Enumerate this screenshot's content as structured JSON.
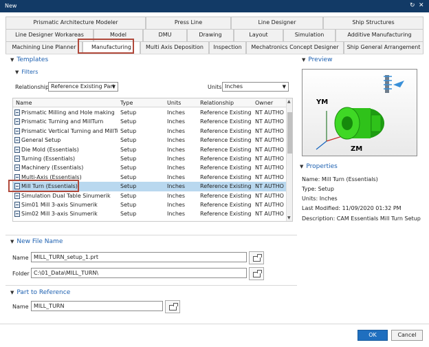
{
  "window": {
    "title": "New"
  },
  "tabs": {
    "row1": [
      "Prismatic Architecture Modeler",
      "Press Line",
      "Line Designer",
      "Ship Structures"
    ],
    "row2": [
      "Line Designer Workareas",
      "Model",
      "DMU",
      "Drawing",
      "Layout",
      "Simulation",
      "Additive Manufacturing"
    ],
    "row3": [
      "Machining Line Planner",
      "Manufacturing",
      "Multi Axis Deposition",
      "Inspection",
      "Mechatronics Concept Designer",
      "Ship General Arrangement"
    ],
    "active": "Manufacturing"
  },
  "templates": {
    "heading": "Templates",
    "filters_heading": "Filters",
    "relationship_label": "Relationship",
    "relationship_value": "Reference Existing Part",
    "units_label": "Units",
    "units_value": "Inches",
    "columns": [
      "Name",
      "Type",
      "Units",
      "Relationship",
      "Owner"
    ],
    "rows": [
      [
        "Prismatic Milling and Hole making",
        "Setup",
        "Inches",
        "Reference Existing",
        "NT AUTHO..."
      ],
      [
        "Prismatic Turning and MillTurn",
        "Setup",
        "Inches",
        "Reference Existing",
        "NT AUTHO..."
      ],
      [
        "Prismatic Vertical Turning and MillTu...",
        "Setup",
        "Inches",
        "Reference Existing",
        "NT AUTHO..."
      ],
      [
        "General Setup",
        "Setup",
        "Inches",
        "Reference Existing",
        "NT AUTHO..."
      ],
      [
        "Die Mold (Essentials)",
        "Setup",
        "Inches",
        "Reference Existing",
        "NT AUTHO..."
      ],
      [
        "Turning (Essentials)",
        "Setup",
        "Inches",
        "Reference Existing",
        "NT AUTHO..."
      ],
      [
        "Machinery (Essentials)",
        "Setup",
        "Inches",
        "Reference Existing",
        "NT AUTHO..."
      ],
      [
        "Multi-Axis (Essentials)",
        "Setup",
        "Inches",
        "Reference Existing",
        "NT AUTHO..."
      ],
      [
        "Mill Turn (Essentials)",
        "Setup",
        "Inches",
        "Reference Existing",
        "NT AUTHO..."
      ],
      [
        "Simulation Dual Table Sinumerik",
        "Setup",
        "Inches",
        "Reference Existing",
        "NT AUTHO..."
      ],
      [
        "Sim01 Mill 3-axis Sinumerik",
        "Setup",
        "Inches",
        "Reference Existing",
        "NT AUTHO..."
      ],
      [
        "Sim02 Mill 3-axis Sinumerik",
        "Setup",
        "Inches",
        "Reference Existing",
        "NT AUTHO..."
      ]
    ],
    "selected_index": 8
  },
  "preview": {
    "heading": "Preview",
    "axis_y": "YM",
    "axis_z": "ZM"
  },
  "properties": {
    "heading": "Properties",
    "name": "Name: Mill Turn (Essentials)",
    "type": "Type: Setup",
    "units": "Units: Inches",
    "modified": "Last Modified: 11/09/2020 01:32 PM",
    "description": "Description: CAM Essentials Mill Turn Setup"
  },
  "new_file": {
    "heading": "New File Name",
    "name_label": "Name",
    "name_value": "MILL_TURN_setup_1.prt",
    "folder_label": "Folder",
    "folder_value": "C:\\01_Data\\MILL_TURN\\"
  },
  "part_reference": {
    "heading": "Part to Reference",
    "name_label": "Name",
    "name_value": "MILL_TURN"
  },
  "buttons": {
    "ok": "OK",
    "cancel": "Cancel"
  },
  "colors": {
    "titlebar": "#123a66",
    "accent": "#1b5fb0",
    "highlight": "#b0483a",
    "selection": "#b9d8ef",
    "part": "#2fc21a"
  }
}
